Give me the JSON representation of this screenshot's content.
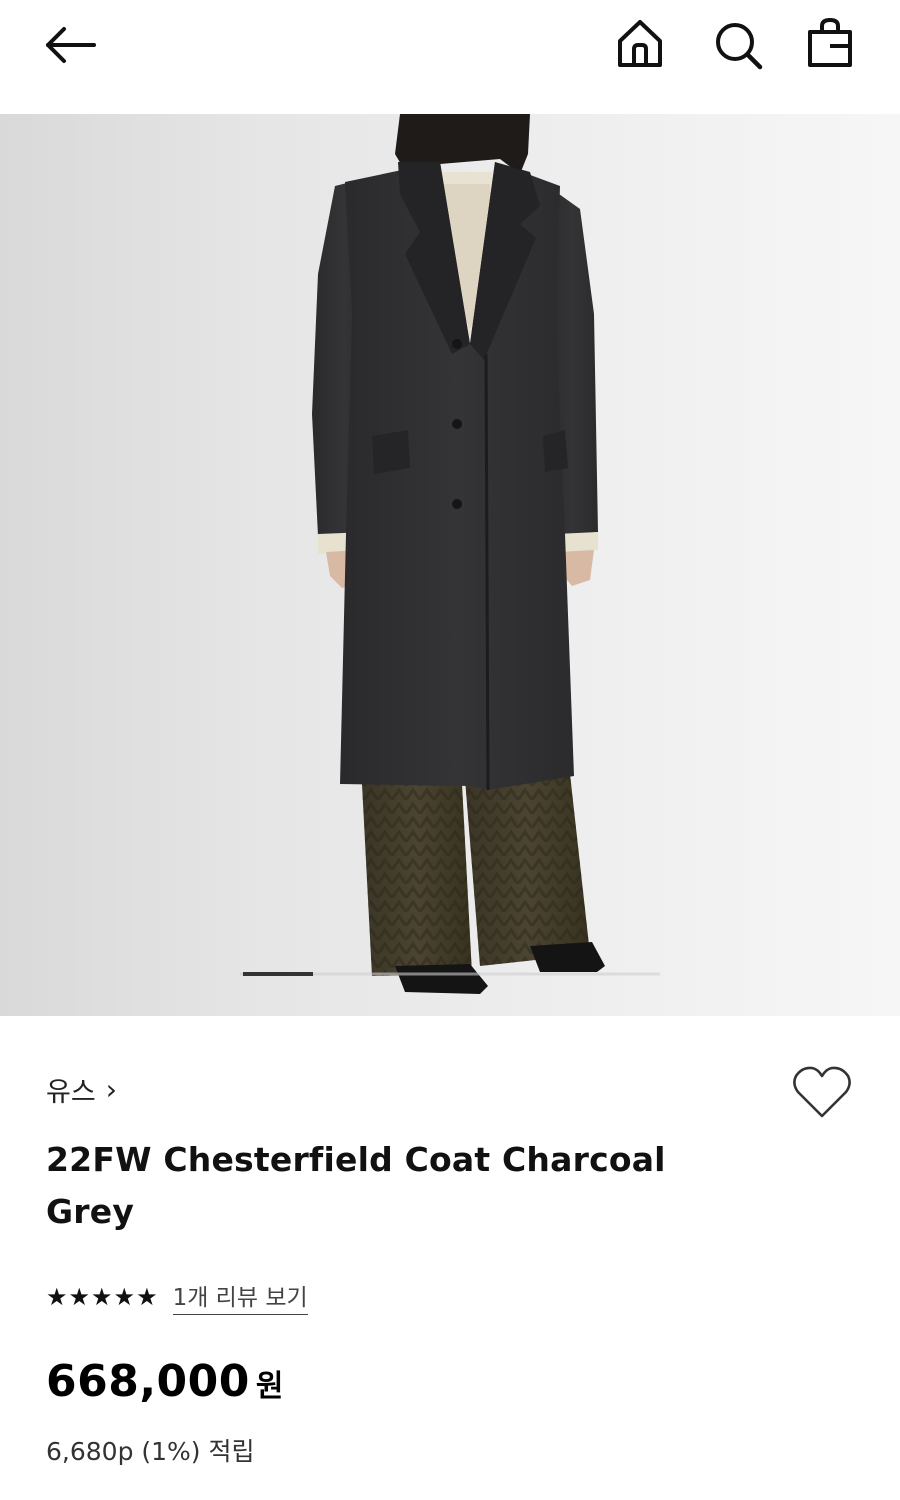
{
  "header": {
    "back_icon": "arrow-left-icon",
    "home_icon": "home-icon",
    "search_icon": "search-icon",
    "bag_icon": "shopping-bag-icon"
  },
  "gallery": {
    "image_alt": "Model wearing charcoal grey chesterfield coat",
    "slide_index": 1,
    "slide_count": 3
  },
  "product": {
    "brand": "유스",
    "brand_chevron": "›",
    "title": "22FW Chesterfield Coat Charcoal Grey",
    "rating_stars": "★★★★★",
    "rating_value": 5,
    "review_link": "1개 리뷰 보기",
    "price": "668,000",
    "currency": "원",
    "points": "6,680p (1%) 적립"
  },
  "colors": {
    "text": "#111111",
    "muted": "#444444",
    "background": "#ffffff"
  }
}
